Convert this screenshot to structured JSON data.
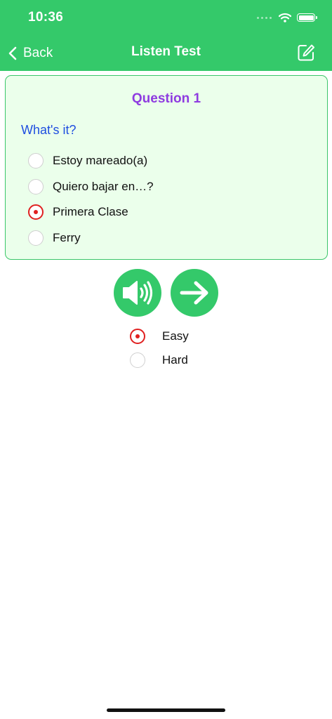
{
  "status_bar": {
    "time": "10:36"
  },
  "nav": {
    "back_label": "Back",
    "title": "Listen Test",
    "back_icon": "chevron-left-icon",
    "edit_icon": "edit-square-icon"
  },
  "question": {
    "number_label": "Question 1",
    "prompt": "What's it?",
    "options": [
      {
        "label": "Estoy mareado(a)",
        "selected": false
      },
      {
        "label": "Quiero bajar en…?",
        "selected": false
      },
      {
        "label": "Primera Clase",
        "selected": true
      },
      {
        "label": "Ferry",
        "selected": false
      }
    ]
  },
  "controls": {
    "play_icon": "speaker-icon",
    "next_icon": "arrow-right-icon"
  },
  "difficulty": {
    "options": [
      {
        "label": "Easy",
        "selected": true
      },
      {
        "label": "Hard",
        "selected": false
      }
    ]
  },
  "colors": {
    "accent_green": "#34c96a",
    "card_background": "#ebffeb",
    "question_purple": "#8e3be0",
    "prompt_blue": "#1f4fe0",
    "radio_selected_red": "#e02020"
  }
}
